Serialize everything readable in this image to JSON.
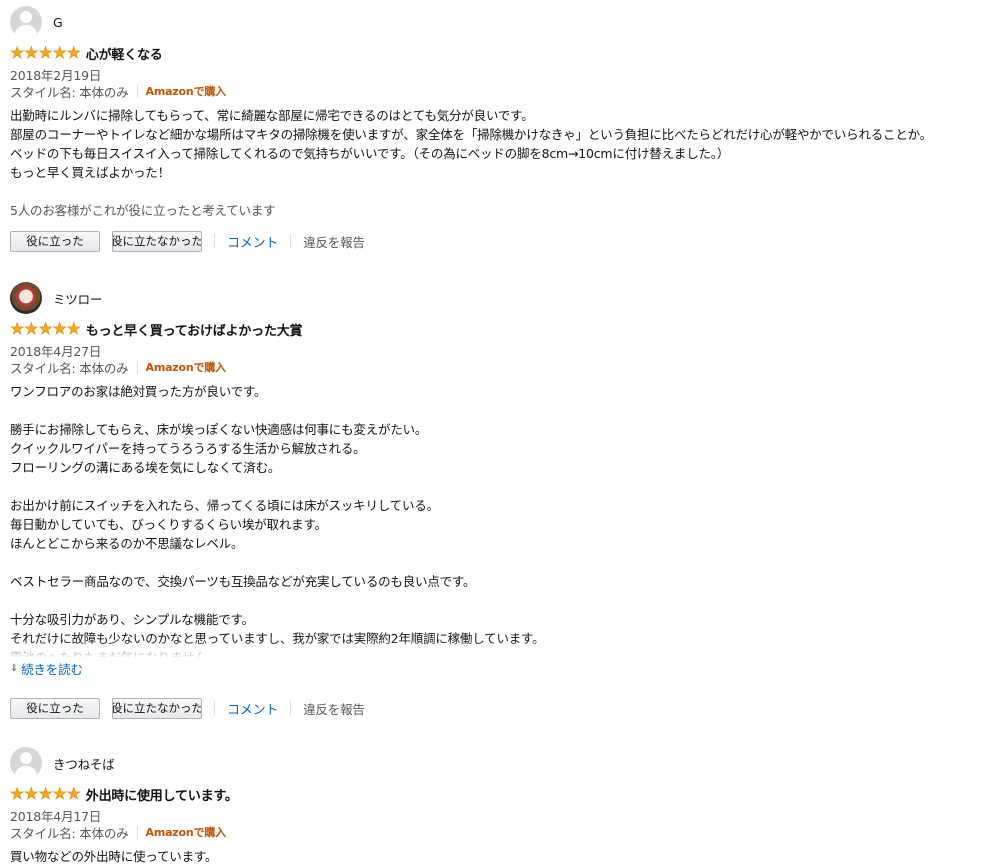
{
  "reviews": [
    {
      "profile_name": "G",
      "avatar": "default-avatar",
      "rating": 5,
      "title": "心が軽くなる",
      "date": "2018年2月19日",
      "style": "スタイル名: 本体のみ",
      "badge": "Amazonで購入",
      "body": "出勤時にルンバに掃除してもらって、常に綺麗な部屋に帰宅できるのはとても気分が良いです。\n部屋のコーナーやトイレなど細かな場所はマキタの掃除機を使いますが、家全体を「掃除機かけなきゃ」という負担に比べたらどれだけ心が軽やかでいられることか。\nベッドの下も毎日スイスイ入って掃除してくれるので気持ちがいいです。（その為にベッドの脚を8cm→10cmに付け替えました。）\nもっと早く買えばよかった！",
      "helpful": "5人のお客様がこれが役に立ったと考えています",
      "helpful_button": "役に立った",
      "not_helpful_button": "役に立たなかった",
      "comment": "コメント",
      "report": "違反を報告"
    },
    {
      "profile_name": "ミツロー",
      "avatar": "photo-avatar",
      "rating": 5,
      "title": "もっと早く買っておけばよかった大賞",
      "date": "2018年4月27日",
      "style": "スタイル名: 本体のみ",
      "badge": "Amazonで購入",
      "body": "ワンフロアのお家は絶対買った方が良いです。\n\n勝手にお掃除してもらえ、床が埃っぽくない快適感は何事にも変えがたい。\nクイックルワイパーを持ってうろうろする生活から解放される。\nフローリングの溝にある埃を気にしなくて済む。\n\nお出かけ前にスイッチを入れたら、帰ってくる頃には床がスッキリしている。\n毎日動かしていても、びっくりするくらい埃が取れます。\nほんとどこから来るのか不思議なレベル。\n\nベストセラー商品なので、交換パーツも互換品などが充実しているのも良い点です。\n\n十分な吸引力があり、シンプルな機能です。\nそれだけに故障も少ないのかなと思っていますし、我が家では実際約2年順調に稼働しています。\n電池のへたりもまだ気になりません。",
      "read_more": "続きを読む",
      "helpful_button": "役に立った",
      "not_helpful_button": "役に立たなかった",
      "comment": "コメント",
      "report": "違反を報告"
    },
    {
      "profile_name": "きつねそば",
      "avatar": "default-avatar",
      "rating": 5,
      "title": "外出時に使用しています。",
      "date": "2018年4月17日",
      "style": "スタイル名: 本体のみ",
      "badge": "Amazonで購入",
      "body": "買い物などの外出時に使っています。"
    }
  ],
  "colors": {
    "star": "#f4a81c",
    "link": "#0066c0",
    "badge": "#c45500",
    "muted": "#555555"
  }
}
